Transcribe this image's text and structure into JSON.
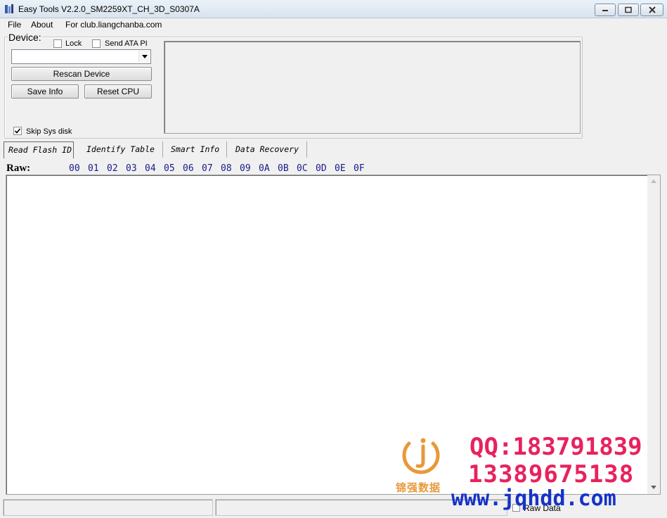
{
  "window": {
    "title": "Easy Tools V2.2.0_SM2259XT_CH_3D_S0307A"
  },
  "menu": [
    "File",
    "About",
    "For club.liangchanba.com"
  ],
  "device": {
    "group_label": "Device:",
    "lock_label": "Lock",
    "lock_checked": false,
    "send_ata_label": "Send ATA PI",
    "send_ata_checked": false,
    "device_select_value": "",
    "rescan_button": "Rescan Device",
    "save_info_button": "Save Info",
    "reset_cpu_button": "Reset CPU",
    "skip_sys_label": "Skip Sys disk",
    "skip_sys_checked": true
  },
  "tabs": [
    {
      "label": "Read Flash ID",
      "active": true
    },
    {
      "label": "Identify Table",
      "active": false
    },
    {
      "label": "Smart Info",
      "active": false
    },
    {
      "label": "Data Recovery",
      "active": false
    }
  ],
  "raw": {
    "label": "Raw:",
    "columns": [
      "00",
      "01",
      "02",
      "03",
      "04",
      "05",
      "06",
      "07",
      "08",
      "09",
      "0A",
      "0B",
      "0C",
      "0D",
      "0E",
      "0F"
    ]
  },
  "status": {
    "raw_data_label": "Raw Data",
    "raw_data_checked": false
  },
  "watermark": {
    "brand_cn": "锦强数据",
    "qq": "QQ:183791839",
    "phone": "13389675138",
    "url": "www.jqhdd.com"
  },
  "colors": {
    "hex_header": "#1a1a8c",
    "watermark_red": "#e8225e",
    "watermark_blue": "#1632c8",
    "watermark_orange": "#e8993a"
  }
}
